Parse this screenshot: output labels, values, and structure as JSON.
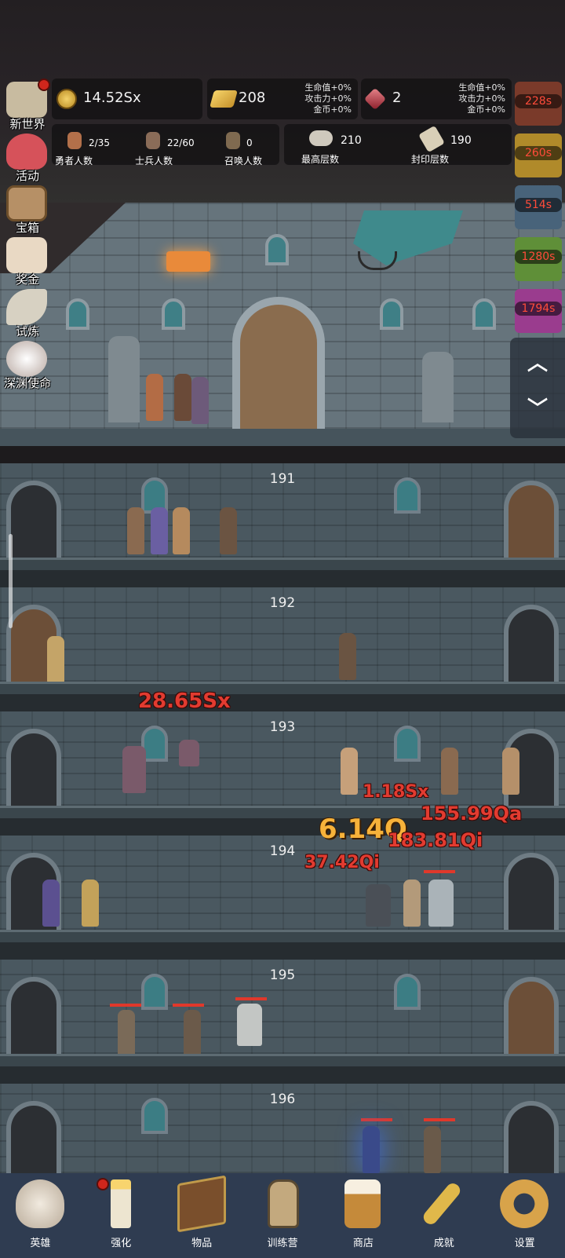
{
  "resources": {
    "gold": "14.52Sx",
    "gold_bar": "208",
    "gem": "2",
    "bonus_lines_1": [
      "生命值+0%",
      "攻击力+0%",
      "金币+0%"
    ],
    "bonus_lines_2": [
      "生命值+0%",
      "攻击力+0%",
      "金币+0%"
    ]
  },
  "stats": {
    "heroes_value": "2/35",
    "heroes_label": "勇者人数",
    "soldiers_value": "22/60",
    "soldiers_label": "士兵人数",
    "summons_value": "0",
    "summons_label": "召唤人数",
    "max_floor_value": "210",
    "max_floor_label": "最高层数",
    "seal_floor_value": "190",
    "seal_floor_label": "封印层数"
  },
  "side_menu": [
    "新世界",
    "活动",
    "宝箱",
    "奖金",
    "试炼",
    "深渊使命"
  ],
  "timers": [
    "228s",
    "260s",
    "514s",
    "1280s",
    "1794s"
  ],
  "floors": [
    "191",
    "192",
    "193",
    "194",
    "195",
    "196"
  ],
  "damage": {
    "d1": "28.65Sx",
    "d2": "1.18Sx",
    "d3": "155.99Qa",
    "d4": "6.14Q",
    "d5": "183.81Qi",
    "d6": "37.42Qi"
  },
  "bottom_nav": [
    "英雄",
    "强化",
    "物品",
    "训练营",
    "商店",
    "成就",
    "设置"
  ],
  "colors": {
    "accent_red": "#e23b30",
    "nav_bg": "#2f3c51"
  }
}
